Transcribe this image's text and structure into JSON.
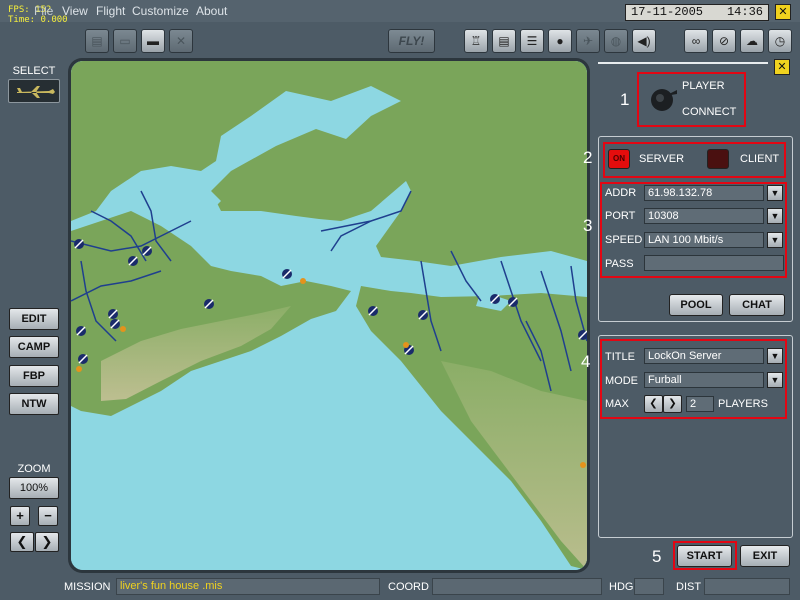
{
  "fps": {
    "fps_text": "FPS:  152",
    "time_text": "Time: 0.000"
  },
  "menu": {
    "file": "File",
    "view": "View",
    "flight": "Flight",
    "customize": "Customize",
    "about": "About"
  },
  "clock": {
    "date": "17-11-2005",
    "time": "14:36"
  },
  "icons": {
    "close": "✕",
    "open_folder": "▭",
    "save": "▬",
    "cancel": "✕",
    "briefing": "♖",
    "doc": "▤",
    "list": "☰",
    "head": "●",
    "plane": "✈",
    "globe": "◍",
    "sound": "◀)",
    "binoculars": "∞",
    "stop": "⊘",
    "weather": "☁",
    "clock": "◷",
    "arrow_left": "❮",
    "arrow_right": "❯",
    "dropdown": "▼"
  },
  "toolbar": {
    "fly_label": "FLY!"
  },
  "left": {
    "select_label": "SELECT",
    "edit": "EDIT",
    "camp": "CAMP",
    "fbp": "FBP",
    "ntw": "NTW",
    "zoom_label": "ZOOM",
    "zoom_value": "100%",
    "zoom_in": "+",
    "zoom_out": "−"
  },
  "callouts": [
    "1",
    "2",
    "3",
    "4",
    "5"
  ],
  "player": {
    "player_label": "PLAYER",
    "connect_label": "CONNECT"
  },
  "mode": {
    "server_led": "ON",
    "server_label": "SERVER",
    "client_led": "",
    "client_label": "CLIENT"
  },
  "network": {
    "addr_label": "ADDR",
    "addr_value": "61.98.132.78",
    "port_label": "PORT",
    "port_value": "10308",
    "speed_label": "SPEED",
    "speed_value": "LAN 100 Mbit/s",
    "pass_label": "PASS",
    "pass_value": "",
    "pool_button": "POOL",
    "chat_button": "CHAT"
  },
  "session": {
    "title_label": "TITLE",
    "title_value": "LockOn Server",
    "mode_label": "MODE",
    "mode_value": "Furball",
    "max_label": "MAX",
    "max_value": "2",
    "players_label": "PLAYERS"
  },
  "actions": {
    "start": "START",
    "exit": "EXIT"
  },
  "status": {
    "mission_label": "MISSION",
    "mission_value": "liver's fun house .mis",
    "coord_label": "COORD",
    "coord_value": "",
    "hdg_label": "HDG",
    "hdg_value": "",
    "dist_label": "DIST",
    "dist_value": ""
  },
  "colors": {
    "accent_red": "#e30613",
    "button_yellow": "#f0d21e",
    "sea": "#8dd7e2",
    "land": "#7aa55a",
    "mission_text": "#f0d21e"
  }
}
